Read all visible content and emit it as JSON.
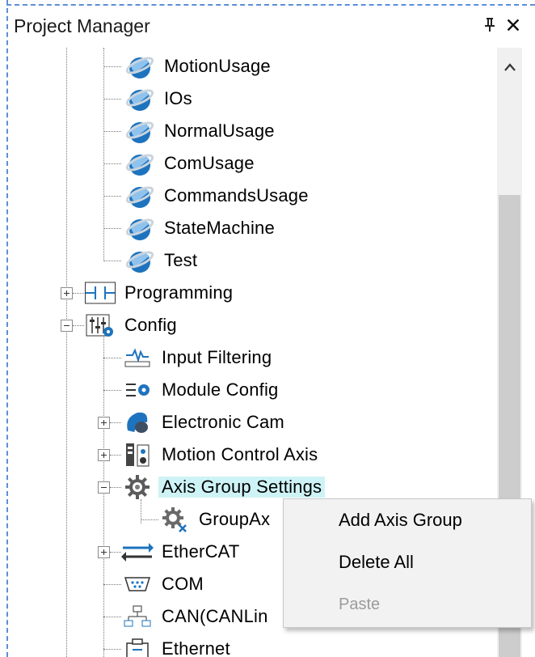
{
  "panel": {
    "title": "Project Manager",
    "pin_glyph": "⊥",
    "close_glyph": "✕"
  },
  "tree": {
    "app_items": [
      {
        "label": "MotionUsage",
        "icon": "globe-icon"
      },
      {
        "label": "IOs",
        "icon": "globe-icon"
      },
      {
        "label": "NormalUsage",
        "icon": "globe-icon"
      },
      {
        "label": "ComUsage",
        "icon": "globe-icon"
      },
      {
        "label": "CommandsUsage",
        "icon": "globe-icon"
      },
      {
        "label": "StateMachine",
        "icon": "globe-icon"
      },
      {
        "label": "Test",
        "icon": "globe-icon"
      }
    ],
    "programming": {
      "label": "Programming",
      "icon": "ladder-icon",
      "expanded": false
    },
    "config": {
      "label": "Config",
      "icon": "config-icon",
      "expanded": true
    },
    "config_items": {
      "input_filtering": {
        "label": "Input Filtering",
        "icon": "signal-filter-icon"
      },
      "module_config": {
        "label": "Module Config",
        "icon": "module-config-icon"
      },
      "electronic_cam": {
        "label": "Electronic Cam",
        "icon": "cam-icon"
      },
      "motion_control_axis": {
        "label": "Motion Control Axis",
        "icon": "axis-icon"
      },
      "axis_group_settings": {
        "label": "Axis Group Settings",
        "icon": "gear-icon",
        "selected": true
      },
      "group_axis": {
        "label": "GroupAx",
        "icon": "gear-x-icon"
      },
      "ethercat": {
        "label": "EtherCAT",
        "icon": "arrows-icon"
      },
      "com": {
        "label": "COM",
        "icon": "serial-port-icon"
      },
      "can": {
        "label": "CAN(CANLin",
        "icon": "network-icon"
      },
      "ethernet": {
        "label": "Ethernet",
        "icon": "ethernet-icon"
      }
    }
  },
  "scrollbar": {
    "up_glyph": "^"
  },
  "context_menu": {
    "items": [
      {
        "label": "Add Axis Group",
        "enabled": true
      },
      {
        "label": "Delete All",
        "enabled": true
      },
      {
        "label": "Paste",
        "enabled": false
      }
    ]
  },
  "colors": {
    "selection": "#cef3f6",
    "globe_blue": "#1e73be",
    "accent_dash": "#5b8fd6"
  }
}
